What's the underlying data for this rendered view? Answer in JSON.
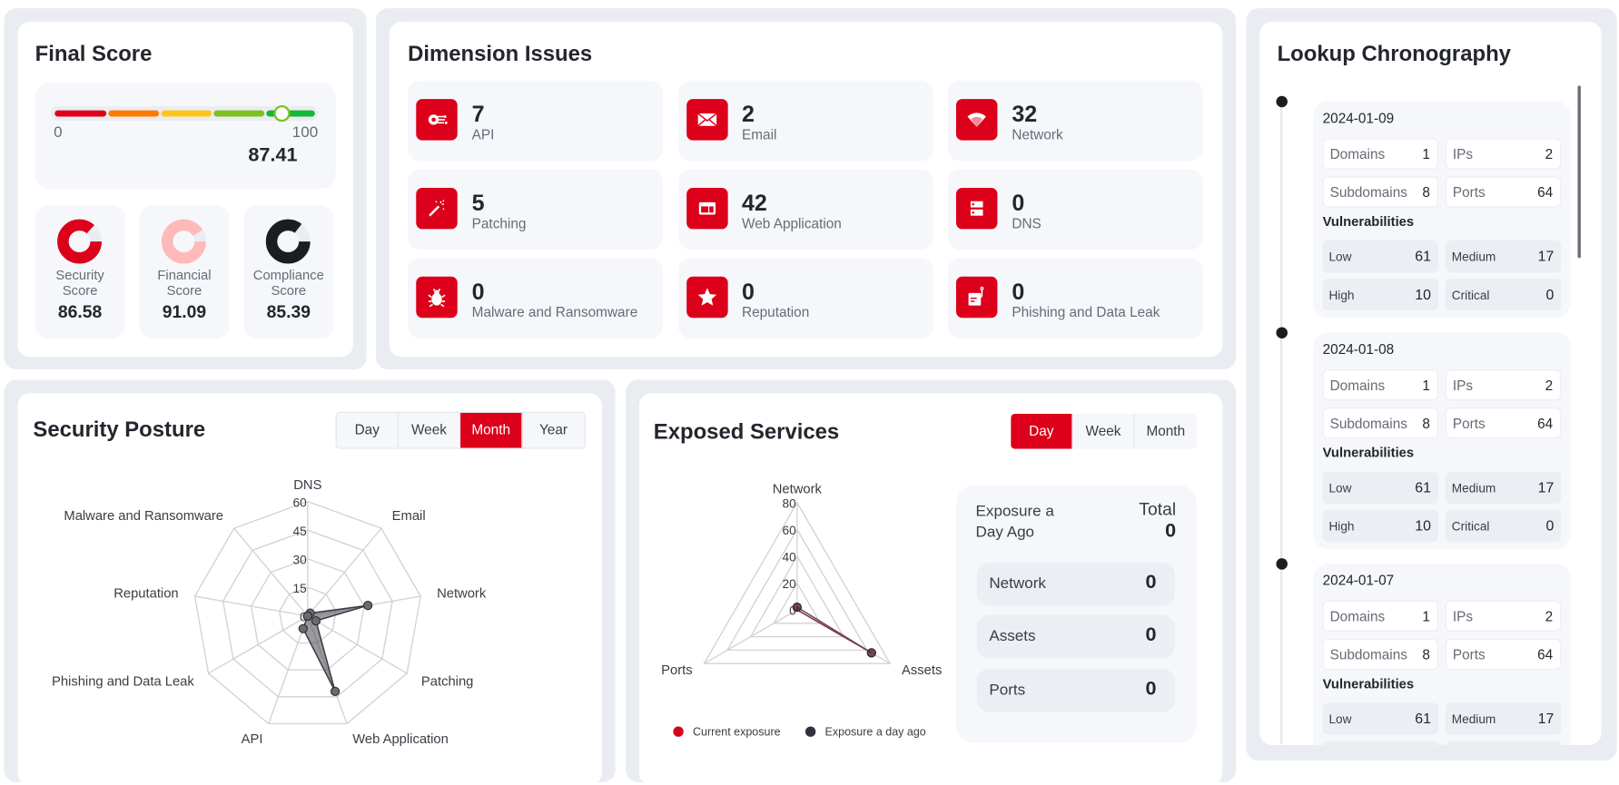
{
  "colors": {
    "accent": "#dc001a",
    "security": "#dc001a",
    "financial": "#ffb9b9",
    "compliance": "#1c1d21",
    "gauge_segments": [
      "#dc001a",
      "#ff7a00",
      "#ffc61a",
      "#7cc21e",
      "#10b936"
    ]
  },
  "final_score": {
    "title": "Final Score",
    "gauge": {
      "min_label": "0",
      "max_label": "100",
      "value": "87.41",
      "value_num": 87.41
    },
    "scores": [
      {
        "label_1": "Security",
        "label_2": "Score",
        "value": "86.58",
        "value_num": 86.58
      },
      {
        "label_1": "Financial",
        "label_2": "Score",
        "value": "91.09",
        "value_num": 91.09
      },
      {
        "label_1": "Compliance",
        "label_2": "Score",
        "value": "85.39",
        "value_num": 85.39
      }
    ]
  },
  "dimension_issues": {
    "title": "Dimension Issues",
    "items": [
      {
        "count": "7",
        "label": "API",
        "icon": "api-gear-icon"
      },
      {
        "count": "2",
        "label": "Email",
        "icon": "envelope-icon"
      },
      {
        "count": "32",
        "label": "Network",
        "icon": "wifi-icon"
      },
      {
        "count": "5",
        "label": "Patching",
        "icon": "magic-wand-icon"
      },
      {
        "count": "42",
        "label": "Web Application",
        "icon": "browser-window-icon"
      },
      {
        "count": "0",
        "label": "DNS",
        "icon": "server-icon"
      },
      {
        "count": "0",
        "label": "Malware and Ransomware",
        "icon": "bug-icon"
      },
      {
        "count": "0",
        "label": "Reputation",
        "icon": "star-icon"
      },
      {
        "count": "0",
        "label": "Phishing and Data Leak",
        "icon": "phishing-hook-icon"
      }
    ]
  },
  "chronography": {
    "title": "Lookup Chronography",
    "vuln_title": "Vulnerabilities",
    "entries": [
      {
        "date": "2024-01-09",
        "domains": "1",
        "ips": "2",
        "subdomains": "8",
        "ports": "64",
        "low": "61",
        "medium": "17",
        "high": "10",
        "critical": "0"
      },
      {
        "date": "2024-01-08",
        "domains": "1",
        "ips": "2",
        "subdomains": "8",
        "ports": "64",
        "low": "61",
        "medium": "17",
        "high": "10",
        "critical": "0"
      },
      {
        "date": "2024-01-07",
        "domains": "1",
        "ips": "2",
        "subdomains": "8",
        "ports": "64",
        "low": "61",
        "medium": "17",
        "high": "10",
        "critical": "0"
      }
    ],
    "labels": {
      "domains": "Domains",
      "ips": "IPs",
      "subdomains": "Subdomains",
      "ports": "Ports",
      "low": "Low",
      "medium": "Medium",
      "high": "High",
      "critical": "Critical"
    }
  },
  "security_posture": {
    "title": "Security Posture",
    "tabs": [
      "Day",
      "Week",
      "Month",
      "Year"
    ],
    "active_tab": "Month"
  },
  "exposed_services": {
    "title": "Exposed Services",
    "tabs": [
      "Day",
      "Week",
      "Month"
    ],
    "active_tab": "Day",
    "summary": {
      "title": "Exposure a Day Ago",
      "total_label": "Total",
      "total": "0",
      "rows": [
        {
          "label": "Network",
          "value": "0"
        },
        {
          "label": "Assets",
          "value": "0"
        },
        {
          "label": "Ports",
          "value": "0"
        }
      ]
    }
  },
  "chart_data": [
    {
      "type": "radar",
      "categories": [
        "DNS",
        "Email",
        "Network",
        "Patching",
        "Web Application",
        "API",
        "Phishing and Data Leak",
        "Reputation",
        "Malware and Ransomware"
      ],
      "ticks": [
        "0",
        "15",
        "30",
        "45",
        "60"
      ],
      "rmax": 60,
      "series": [
        {
          "values": [
            0,
            2,
            32,
            5,
            42,
            7,
            0,
            0,
            0
          ],
          "color": "#3a3b42"
        }
      ]
    },
    {
      "type": "radar",
      "categories": [
        "Network",
        "Assets",
        "Ports"
      ],
      "ticks": [
        "0",
        "20",
        "40",
        "60",
        "80"
      ],
      "rmax": 80,
      "legend": "bottom",
      "series": [
        {
          "name": "Current exposure",
          "values": [
            2,
            64,
            0
          ],
          "color": "#dc001a"
        },
        {
          "name": "Exposure a day ago",
          "values": [
            2,
            64,
            0
          ],
          "color": "#30323b"
        }
      ]
    }
  ]
}
